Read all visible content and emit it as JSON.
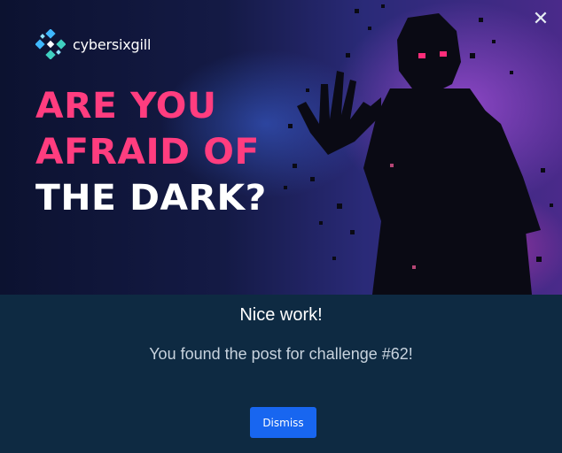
{
  "brand": {
    "name": "cybersixgill",
    "icon": "cybersixgill-logo-icon"
  },
  "hero": {
    "line1": "ARE YOU",
    "line2": "AFRAID OF",
    "line3": "THE DARK?"
  },
  "close_icon": "close-icon",
  "dialog": {
    "title": "Nice work!",
    "message": "You found the post for challenge #62!",
    "dismiss_label": "Dismiss"
  },
  "colors": {
    "accent_pink": "#ff3d7f",
    "button_blue": "#1866f0",
    "panel_bg": "#0e2a42"
  }
}
